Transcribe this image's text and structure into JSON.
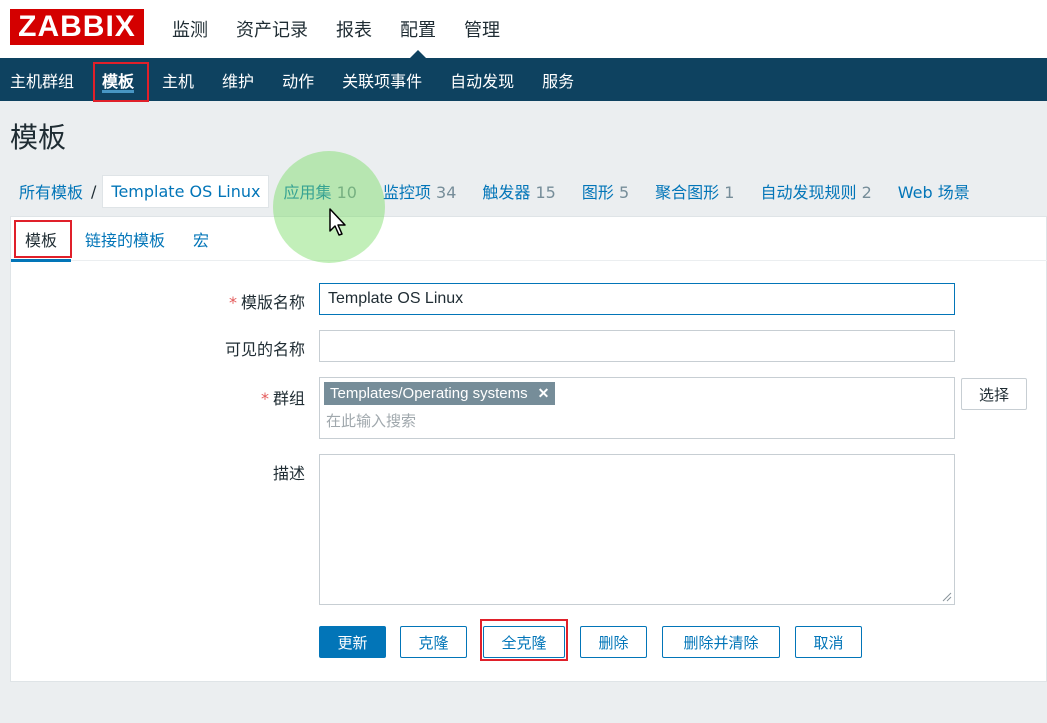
{
  "logo": "ZABBIX",
  "main_menu": [
    "监测",
    "资产记录",
    "报表",
    "配置",
    "管理"
  ],
  "sub_menu": [
    "主机群组",
    "模板",
    "主机",
    "维护",
    "动作",
    "关联项事件",
    "自动发现",
    "服务"
  ],
  "page_title": "模板",
  "template_nav": {
    "all_templates": "所有模板",
    "separator": "/",
    "current": "Template OS Linux",
    "links": [
      {
        "label": "应用集",
        "count": "10"
      },
      {
        "label": "监控项",
        "count": "34"
      },
      {
        "label": "触发器",
        "count": "15"
      },
      {
        "label": "图形",
        "count": "5"
      },
      {
        "label": "聚合图形",
        "count": "1"
      },
      {
        "label": "自动发现规则",
        "count": "2"
      },
      {
        "label": "Web 场景",
        "count": ""
      }
    ]
  },
  "tabs": [
    "模板",
    "链接的模板",
    "宏"
  ],
  "form": {
    "template_name_label": "模版名称",
    "template_name_value": "Template OS Linux",
    "visible_name_label": "可见的名称",
    "visible_name_value": "",
    "groups_label": "群组",
    "group_chip": "Templates/Operating systems",
    "group_search_placeholder": "在此输入搜索",
    "select_button": "选择",
    "description_label": "描述",
    "description_value": "",
    "required_mark": "*"
  },
  "buttons": {
    "update": "更新",
    "clone": "克隆",
    "full_clone": "全克隆",
    "delete": "删除",
    "delete_and_clear": "删除并清除",
    "cancel": "取消"
  },
  "colors": {
    "brand_red": "#d40000",
    "nav_dark": "#0e4260",
    "link_blue": "#0275b8",
    "annotation_red": "#e0202a"
  }
}
